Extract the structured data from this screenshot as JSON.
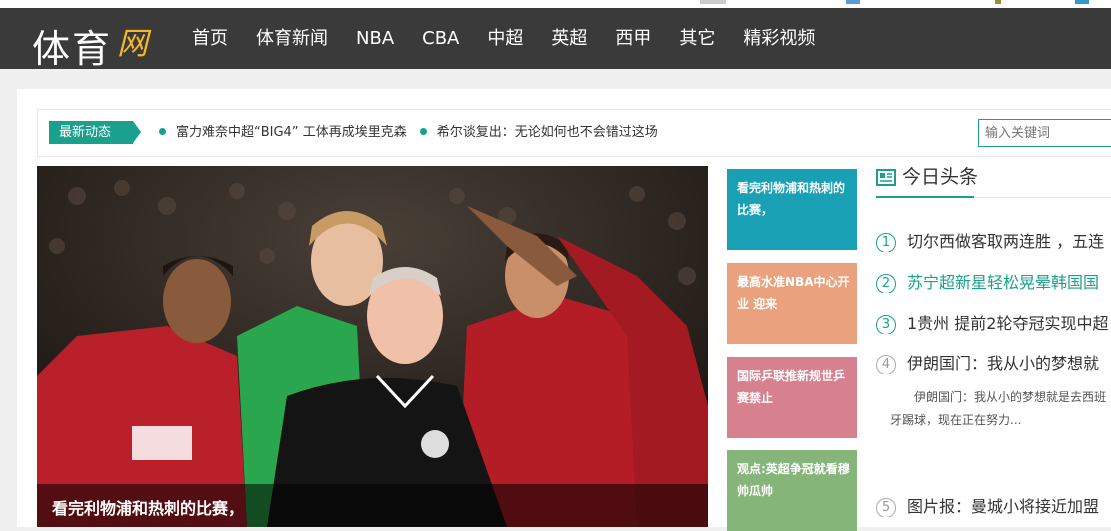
{
  "site": {
    "logo_main": "体育",
    "logo_sub": "网"
  },
  "nav": {
    "items": [
      {
        "label": "首页"
      },
      {
        "label": "体育新闻"
      },
      {
        "label": "NBA"
      },
      {
        "label": "CBA"
      },
      {
        "label": "中超"
      },
      {
        "label": "英超"
      },
      {
        "label": "西甲"
      },
      {
        "label": "其它"
      },
      {
        "label": "精彩视频"
      }
    ]
  },
  "ticker": {
    "badge": "最新动态",
    "items": [
      {
        "text": "富力难奈中超“BIG4” 工体再成埃里克森"
      },
      {
        "text": "希尔谈复出：无论如何也不会错过这场"
      }
    ]
  },
  "search": {
    "placeholder": "输入关键词"
  },
  "hero": {
    "caption": "看完利物浦和热刺的比赛，"
  },
  "tiles": [
    {
      "text": "看完利物浦和热刺的比赛，",
      "color": "#1aa0b4"
    },
    {
      "text": "最高水准NBA中心开业 迎来",
      "color": "#e9a27d"
    },
    {
      "text": "国际乒联推新规世乒赛禁止",
      "color": "#d7818f"
    },
    {
      "text": "观点:英超争冠就看穆帅瓜帅",
      "color": "#86b57a"
    }
  ],
  "headlines": {
    "title": "今日头条",
    "items": [
      {
        "num": "1",
        "text": "切尔西做客取两连胜 ，五连"
      },
      {
        "num": "2",
        "text": "苏宁超新星轻松晃晕韩国国"
      },
      {
        "num": "3",
        "text": "1贵州 提前2轮夺冠实现中超"
      },
      {
        "num": "4",
        "text": "伊朗国门：我从小的梦想就"
      },
      {
        "num": "5",
        "text": "图片报：曼城小将接近加盟"
      }
    ],
    "featured_desc": "伊朗国门：我从小的梦想就是去西班牙踢球，现在正在努力..."
  },
  "colors": {
    "accent": "#1aa08c",
    "navbar": "#3a3a3a",
    "logo_sub": "#f2b72c"
  }
}
